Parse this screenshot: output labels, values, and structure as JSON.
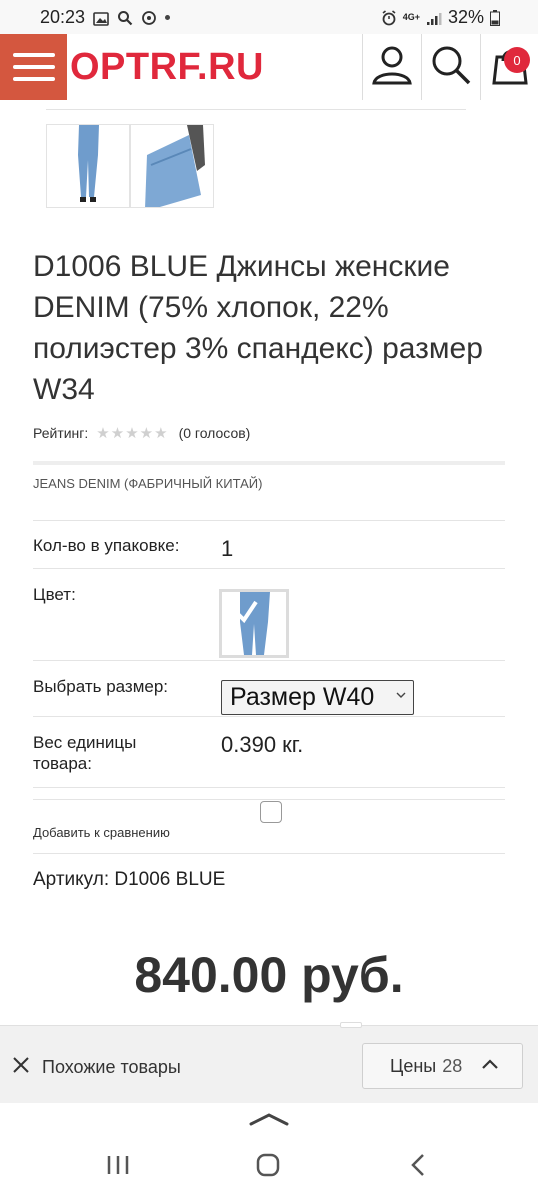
{
  "status_bar": {
    "time": "20:23",
    "network": "4G+",
    "battery": "32%"
  },
  "header": {
    "logo": "OPTRF.RU",
    "cart_count": "0"
  },
  "product": {
    "title": "D1006 BLUE Джинсы женские DENIM (75% хлопок, 22% полиэстер 3% спандекс) размер W34",
    "rating_label": "Рейтинг:",
    "votes": "(0 голосов)",
    "rating_value": 0,
    "brand": "JEANS DENIM (ФАБРИЧНЫЙ КИТАЙ)",
    "qty_label": "Кол-во в упаковке:",
    "qty_value": "1",
    "color_label": "Цвет:",
    "size_label": "Выбрать размер:",
    "size_selected": "Размер W40",
    "weight_label_1": "Вес единицы",
    "weight_label_2": "товара:",
    "weight_value": "0.390 кг.",
    "compare_label": "Добавить к сравнению",
    "sku": "Артикул: D1006 BLUE",
    "price": "840.00 руб."
  },
  "bottom_bar": {
    "similar_label": "Похожие товары",
    "prices_label": "Цены",
    "prices_count": "28"
  },
  "colors": {
    "brand_red": "#e0283c",
    "menu_bg": "#d4573f",
    "denim": "#6f9ccc"
  }
}
